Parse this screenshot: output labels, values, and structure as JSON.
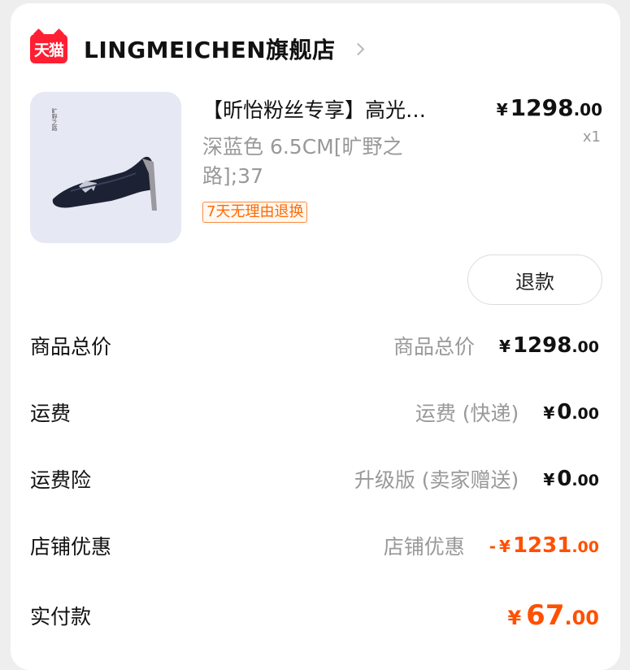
{
  "store": {
    "badge_text": "天猫",
    "name": "LINGMEICHEN旗舰店",
    "chevron_icon": "chevron-right-icon"
  },
  "product": {
    "title": "【昕怡粉丝专享】高光…",
    "spec": "深蓝色 6.5CM[旷野之路];37",
    "tag": "7天无理由退换",
    "price": {
      "symbol": "¥",
      "int": "1298",
      "dec": ".00"
    },
    "quantity": "x1",
    "image_text": "旷野之路"
  },
  "refund_button": "退款",
  "summary": [
    {
      "label": "商品总价",
      "desc": "商品总价",
      "prefix": "",
      "symbol": "¥",
      "int": "1298",
      "dec": ".00"
    },
    {
      "label": "运费",
      "desc": "运费 (快递)",
      "prefix": "",
      "symbol": "¥",
      "int": "0",
      "dec": ".00"
    },
    {
      "label": "运费险",
      "desc": "升级版 (卖家赠送)",
      "prefix": "",
      "symbol": "¥",
      "int": "0",
      "dec": ".00"
    },
    {
      "label": "店铺优惠",
      "desc": "店铺优惠",
      "prefix": "-",
      "symbol": "¥",
      "int": "1231",
      "dec": ".00"
    }
  ],
  "paid": {
    "label": "实付款",
    "symbol": "¥",
    "int": "67",
    "dec": ".00"
  },
  "colors": {
    "accent": "#ff5000",
    "tmall_red": "#ff1e32",
    "muted": "#999999"
  }
}
